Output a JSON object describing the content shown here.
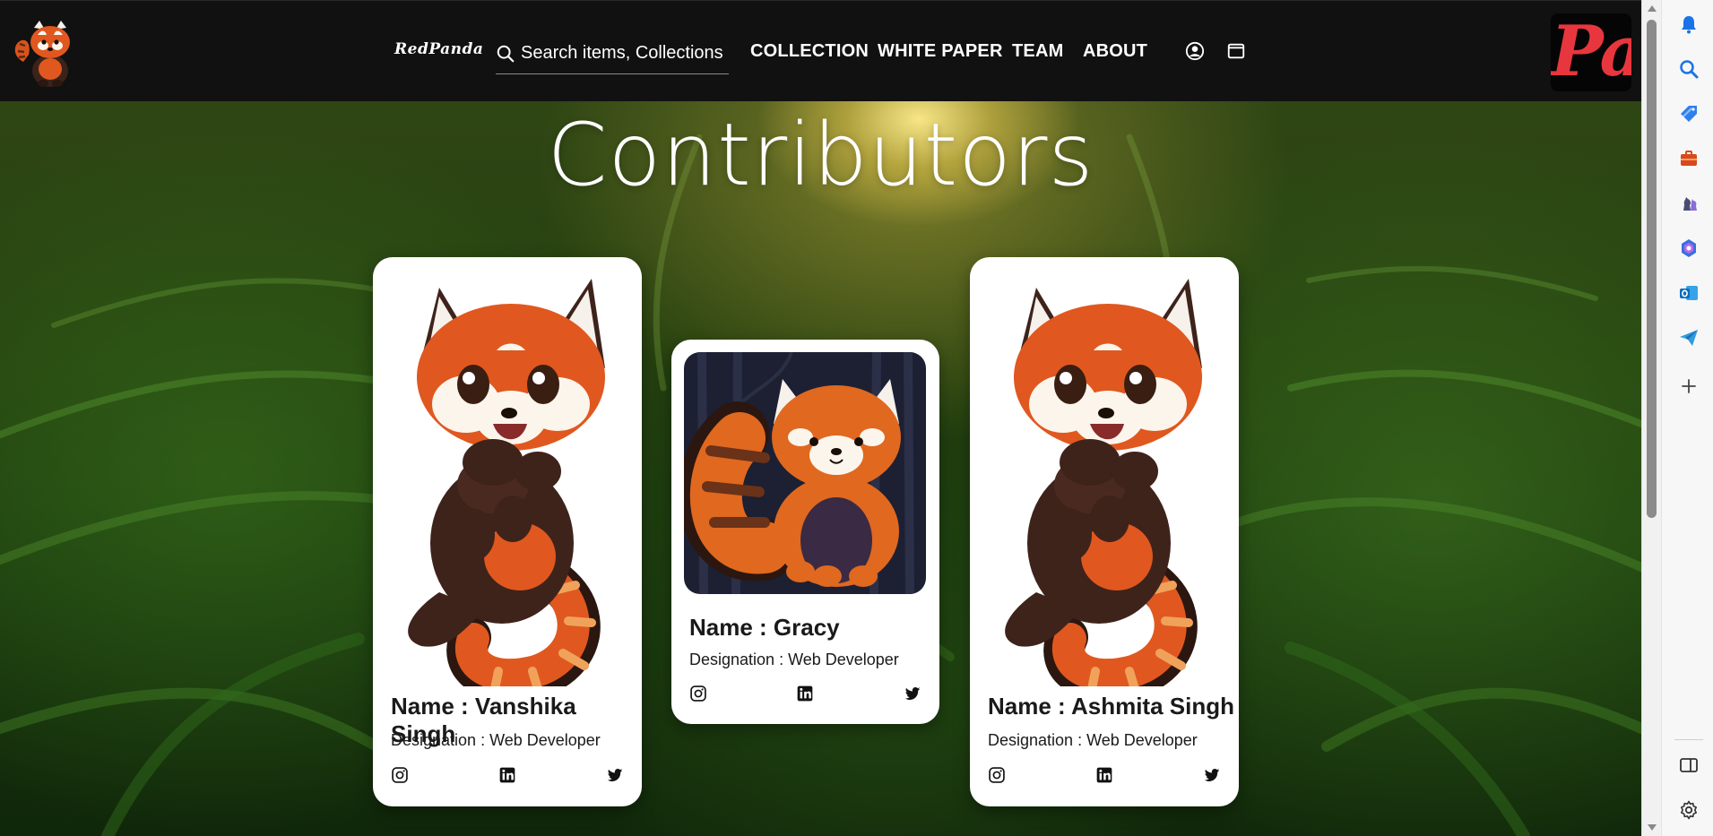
{
  "navbar": {
    "brand": "RedPanda",
    "search_placeholder": "Search items, Collections",
    "links": [
      "COLLECTION",
      "WHITE PAPER",
      "TEAM",
      "ABOUT"
    ],
    "icons": [
      "user-circle-icon",
      "wallet-icon"
    ],
    "corner_logo_text": "Pa"
  },
  "hero": {
    "title": "Contributors"
  },
  "contributors": [
    {
      "name": "Name : Vanshika Singh",
      "designation": "Designation : Web Developer",
      "socials": [
        "instagram-icon",
        "linkedin-icon",
        "twitter-icon"
      ]
    },
    {
      "name": "Name : Gracy",
      "designation": "Designation : Web Developer",
      "socials": [
        "instagram-icon",
        "linkedin-icon",
        "twitter-icon"
      ]
    },
    {
      "name": "Name : Ashmita Singh",
      "designation": "Designation : Web Developer",
      "socials": [
        "instagram-icon",
        "linkedin-icon",
        "twitter-icon"
      ]
    }
  ],
  "browser_sidebar": {
    "icons": [
      "bell-icon",
      "search-icon",
      "tag-icon",
      "briefcase-icon",
      "chess-icon",
      "copilot-icon",
      "outlook-icon",
      "send-icon",
      "plus-icon",
      "split-screen-icon",
      "settings-icon"
    ]
  },
  "colors": {
    "navbar_bg": "#111111",
    "card_bg": "#ffffff",
    "panda_orange": "#e0581f",
    "accent_red": "#e8363f"
  }
}
